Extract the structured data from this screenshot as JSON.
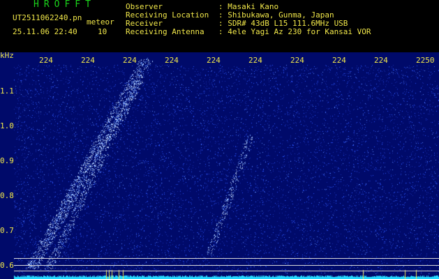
{
  "header": {
    "logo": "HROFFT",
    "filename": "UT2511062240.pn",
    "tag": "meteor",
    "datetime": "25.11.06 22:40",
    "count": "10",
    "info": [
      {
        "key": "Observer",
        "value": ": Masaki Kano"
      },
      {
        "key": "Receiving Location",
        "value": ": Shibukawa, Gunma, Japan"
      },
      {
        "key": "Receiver",
        "value": ": SDR# 43dB L15 111.6MHz USB"
      },
      {
        "key": "Receiving Antenna",
        "value": ": 4ele Yagi Az 230 for Kansai VOR"
      }
    ]
  },
  "spectrogram": {
    "yunit": "kHz",
    "yticks": [
      "1.1",
      "1.0",
      "0.9",
      "0.8",
      "0.7",
      "0.6"
    ],
    "xticks": [
      "224",
      "224",
      "224",
      "224",
      "224",
      "224",
      "224",
      "224",
      "224",
      "2250"
    ],
    "colors": {
      "background": "#000a6a",
      "noise": "#2c56ff",
      "signal": "#c8e0ff",
      "baseline": "#27d9ff",
      "marker": "#f2e84a"
    }
  }
}
